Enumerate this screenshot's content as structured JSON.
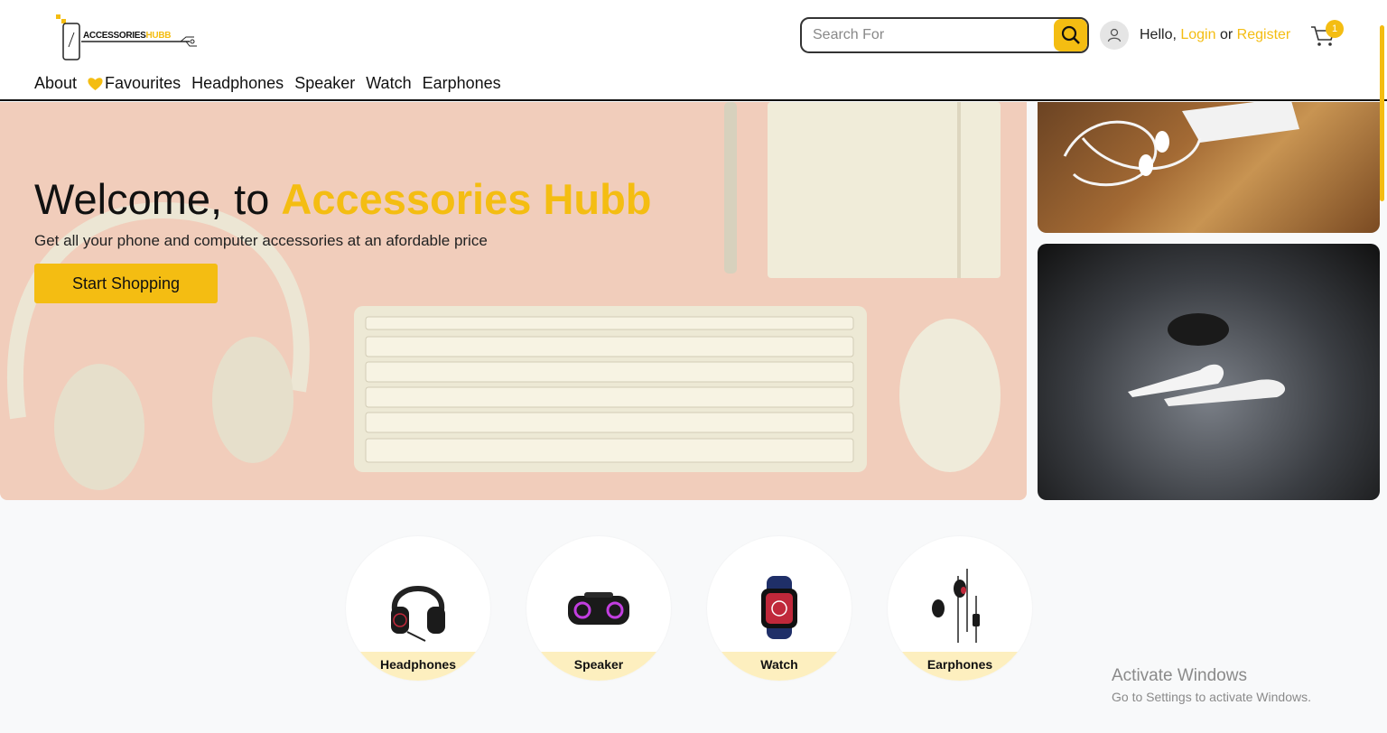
{
  "brand": {
    "logo_part1": "ACCESSORIES",
    "logo_part2": "HUBB"
  },
  "header": {
    "search_placeholder": "Search For",
    "greeting": "Hello,",
    "login": "Login",
    "or": "or",
    "register": "Register",
    "cart_count": "1"
  },
  "nav": {
    "items": [
      "About",
      "Favourites",
      "Headphones",
      "Speaker",
      "Watch",
      "Earphones"
    ]
  },
  "hero": {
    "title_prefix": "Welcome, to ",
    "title_brand": "Accessories Hubb",
    "subtitle": "Get all your phone and computer accessories at an afordable price",
    "button": "Start Shopping"
  },
  "categories": [
    {
      "label": "Headphones",
      "icon": "headphones-image"
    },
    {
      "label": "Speaker",
      "icon": "speaker-image"
    },
    {
      "label": "Watch",
      "icon": "watch-image"
    },
    {
      "label": "Earphones",
      "icon": "earphones-image"
    }
  ],
  "watermark": {
    "line1": "Activate Windows",
    "line2": "Go to Settings to activate Windows."
  },
  "colors": {
    "accent": "#f4bd12",
    "hero_bg": "#f1cdbb",
    "label_bg": "#fdefbf"
  }
}
